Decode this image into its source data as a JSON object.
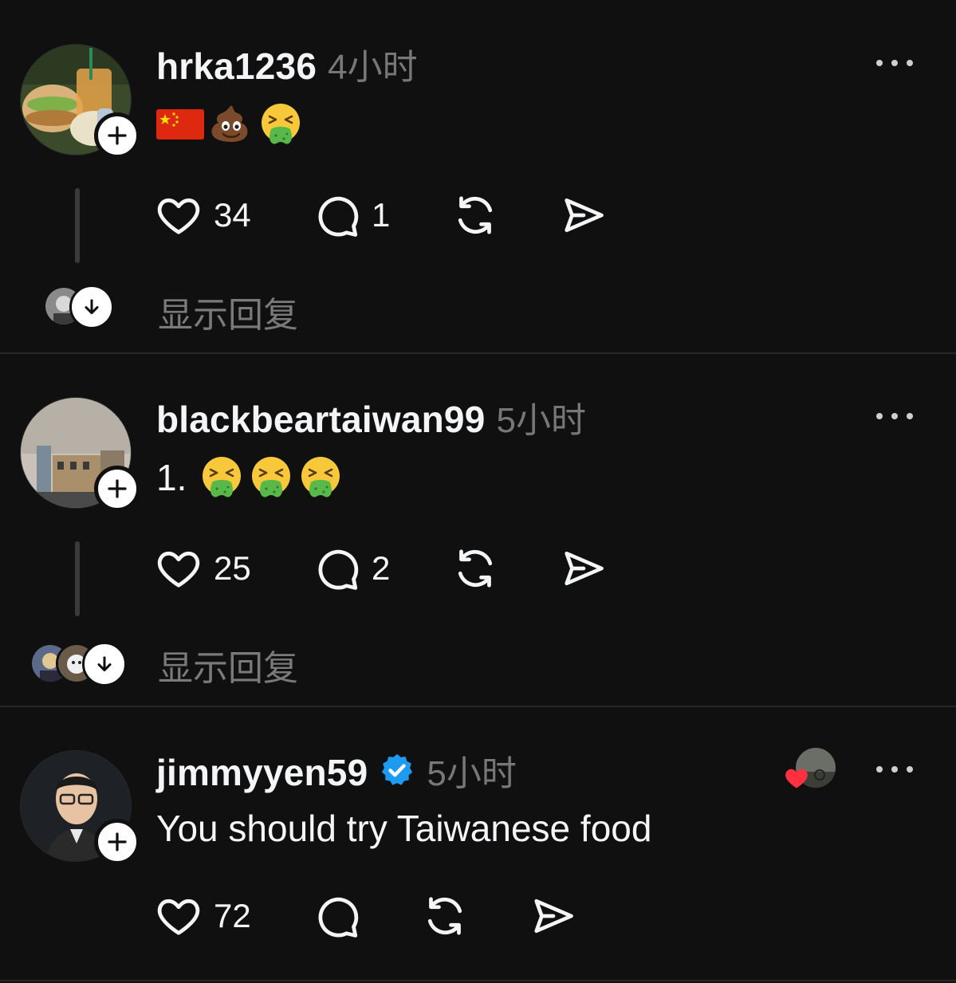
{
  "colors": {
    "background": "#101010",
    "text": "#f3f5f7",
    "muted": "#777777",
    "divider": "#262626",
    "verified": "#1d9bf0",
    "like_red": "#ff3040"
  },
  "posts": [
    {
      "username": "hrka1236",
      "time": "4小时",
      "content_emojis": [
        "china-flag",
        "pile-of-poo",
        "vomiting-face"
      ],
      "like_count": "34",
      "comment_count": "1",
      "show_replies": "显示回复"
    },
    {
      "username": "blackbeartaiwan99",
      "time": "5小时",
      "content_text": "1.",
      "content_emojis": [
        "vomiting-face",
        "vomiting-face",
        "vomiting-face"
      ],
      "like_count": "25",
      "comment_count": "2",
      "show_replies": "显示回复"
    },
    {
      "username": "jimmyyen59",
      "time": "5小时",
      "verified": true,
      "content_text": "You should try Taiwanese food",
      "like_count": "72",
      "liked_by_author": true
    }
  ],
  "icons": [
    "plus-icon",
    "more-icon",
    "heart-icon",
    "comment-icon",
    "repost-icon",
    "share-icon",
    "arrow-down-icon",
    "verified-badge-icon"
  ]
}
